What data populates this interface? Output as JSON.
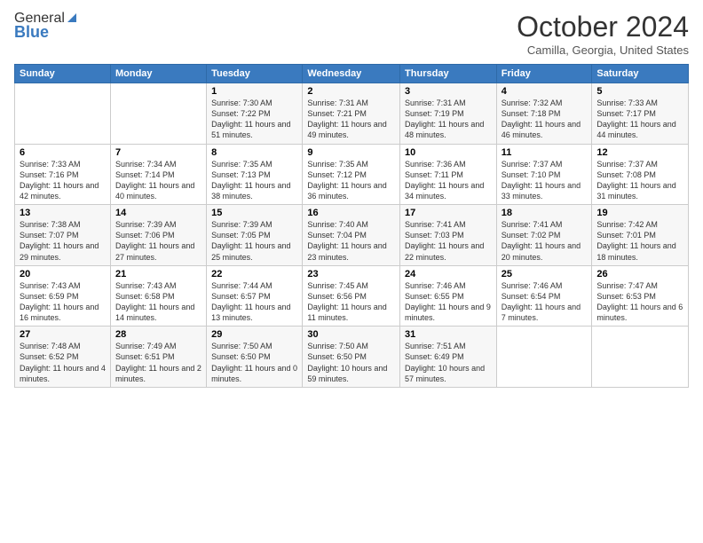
{
  "logo": {
    "general": "General",
    "blue": "Blue"
  },
  "header": {
    "month": "October 2024",
    "location": "Camilla, Georgia, United States"
  },
  "weekdays": [
    "Sunday",
    "Monday",
    "Tuesday",
    "Wednesday",
    "Thursday",
    "Friday",
    "Saturday"
  ],
  "weeks": [
    [
      {
        "day": "",
        "info": ""
      },
      {
        "day": "",
        "info": ""
      },
      {
        "day": "1",
        "info": "Sunrise: 7:30 AM\nSunset: 7:22 PM\nDaylight: 11 hours and 51 minutes."
      },
      {
        "day": "2",
        "info": "Sunrise: 7:31 AM\nSunset: 7:21 PM\nDaylight: 11 hours and 49 minutes."
      },
      {
        "day": "3",
        "info": "Sunrise: 7:31 AM\nSunset: 7:19 PM\nDaylight: 11 hours and 48 minutes."
      },
      {
        "day": "4",
        "info": "Sunrise: 7:32 AM\nSunset: 7:18 PM\nDaylight: 11 hours and 46 minutes."
      },
      {
        "day": "5",
        "info": "Sunrise: 7:33 AM\nSunset: 7:17 PM\nDaylight: 11 hours and 44 minutes."
      }
    ],
    [
      {
        "day": "6",
        "info": "Sunrise: 7:33 AM\nSunset: 7:16 PM\nDaylight: 11 hours and 42 minutes."
      },
      {
        "day": "7",
        "info": "Sunrise: 7:34 AM\nSunset: 7:14 PM\nDaylight: 11 hours and 40 minutes."
      },
      {
        "day": "8",
        "info": "Sunrise: 7:35 AM\nSunset: 7:13 PM\nDaylight: 11 hours and 38 minutes."
      },
      {
        "day": "9",
        "info": "Sunrise: 7:35 AM\nSunset: 7:12 PM\nDaylight: 11 hours and 36 minutes."
      },
      {
        "day": "10",
        "info": "Sunrise: 7:36 AM\nSunset: 7:11 PM\nDaylight: 11 hours and 34 minutes."
      },
      {
        "day": "11",
        "info": "Sunrise: 7:37 AM\nSunset: 7:10 PM\nDaylight: 11 hours and 33 minutes."
      },
      {
        "day": "12",
        "info": "Sunrise: 7:37 AM\nSunset: 7:08 PM\nDaylight: 11 hours and 31 minutes."
      }
    ],
    [
      {
        "day": "13",
        "info": "Sunrise: 7:38 AM\nSunset: 7:07 PM\nDaylight: 11 hours and 29 minutes."
      },
      {
        "day": "14",
        "info": "Sunrise: 7:39 AM\nSunset: 7:06 PM\nDaylight: 11 hours and 27 minutes."
      },
      {
        "day": "15",
        "info": "Sunrise: 7:39 AM\nSunset: 7:05 PM\nDaylight: 11 hours and 25 minutes."
      },
      {
        "day": "16",
        "info": "Sunrise: 7:40 AM\nSunset: 7:04 PM\nDaylight: 11 hours and 23 minutes."
      },
      {
        "day": "17",
        "info": "Sunrise: 7:41 AM\nSunset: 7:03 PM\nDaylight: 11 hours and 22 minutes."
      },
      {
        "day": "18",
        "info": "Sunrise: 7:41 AM\nSunset: 7:02 PM\nDaylight: 11 hours and 20 minutes."
      },
      {
        "day": "19",
        "info": "Sunrise: 7:42 AM\nSunset: 7:01 PM\nDaylight: 11 hours and 18 minutes."
      }
    ],
    [
      {
        "day": "20",
        "info": "Sunrise: 7:43 AM\nSunset: 6:59 PM\nDaylight: 11 hours and 16 minutes."
      },
      {
        "day": "21",
        "info": "Sunrise: 7:43 AM\nSunset: 6:58 PM\nDaylight: 11 hours and 14 minutes."
      },
      {
        "day": "22",
        "info": "Sunrise: 7:44 AM\nSunset: 6:57 PM\nDaylight: 11 hours and 13 minutes."
      },
      {
        "day": "23",
        "info": "Sunrise: 7:45 AM\nSunset: 6:56 PM\nDaylight: 11 hours and 11 minutes."
      },
      {
        "day": "24",
        "info": "Sunrise: 7:46 AM\nSunset: 6:55 PM\nDaylight: 11 hours and 9 minutes."
      },
      {
        "day": "25",
        "info": "Sunrise: 7:46 AM\nSunset: 6:54 PM\nDaylight: 11 hours and 7 minutes."
      },
      {
        "day": "26",
        "info": "Sunrise: 7:47 AM\nSunset: 6:53 PM\nDaylight: 11 hours and 6 minutes."
      }
    ],
    [
      {
        "day": "27",
        "info": "Sunrise: 7:48 AM\nSunset: 6:52 PM\nDaylight: 11 hours and 4 minutes."
      },
      {
        "day": "28",
        "info": "Sunrise: 7:49 AM\nSunset: 6:51 PM\nDaylight: 11 hours and 2 minutes."
      },
      {
        "day": "29",
        "info": "Sunrise: 7:50 AM\nSunset: 6:50 PM\nDaylight: 11 hours and 0 minutes."
      },
      {
        "day": "30",
        "info": "Sunrise: 7:50 AM\nSunset: 6:50 PM\nDaylight: 10 hours and 59 minutes."
      },
      {
        "day": "31",
        "info": "Sunrise: 7:51 AM\nSunset: 6:49 PM\nDaylight: 10 hours and 57 minutes."
      },
      {
        "day": "",
        "info": ""
      },
      {
        "day": "",
        "info": ""
      }
    ]
  ]
}
